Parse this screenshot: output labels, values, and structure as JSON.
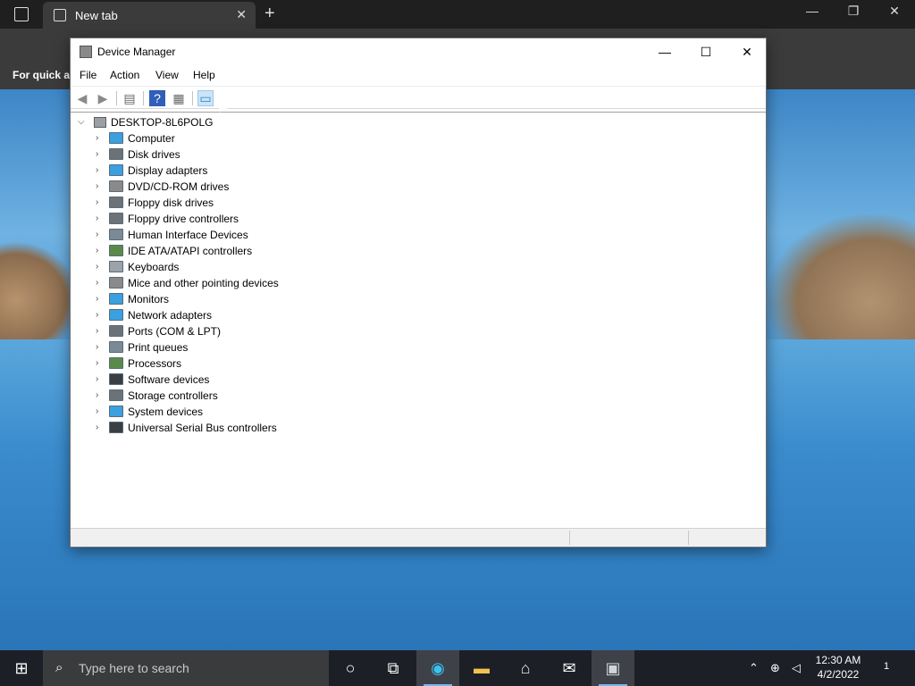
{
  "browser": {
    "tab_title": "New tab",
    "favorites_text": "For quick ac"
  },
  "window": {
    "title": "Device Manager",
    "controls": {
      "minimize": "—",
      "maximize": "☐",
      "close": "✕"
    }
  },
  "menu": [
    "File",
    "Action",
    "View",
    "Help"
  ],
  "toolbar": {
    "buttons": [
      "back-icon",
      "forward-icon",
      "properties-icon",
      "help-icon",
      "view-icon",
      "monitor-scan-icon"
    ]
  },
  "tree": {
    "root": "DESKTOP-8L6POLG",
    "items": [
      {
        "label": "Computer",
        "icon": "computer-icon",
        "color": "#3aa0e0"
      },
      {
        "label": "Disk drives",
        "icon": "disk-drive-icon",
        "color": "#6b7378"
      },
      {
        "label": "Display adapters",
        "icon": "display-adapter-icon",
        "color": "#3aa0e0"
      },
      {
        "label": "DVD/CD-ROM drives",
        "icon": "dvd-drive-icon",
        "color": "#8a8a8a"
      },
      {
        "label": "Floppy disk drives",
        "icon": "floppy-disk-icon",
        "color": "#6b7378"
      },
      {
        "label": "Floppy drive controllers",
        "icon": "floppy-controller-icon",
        "color": "#6b7378"
      },
      {
        "label": "Human Interface Devices",
        "icon": "hid-icon",
        "color": "#7a8a96"
      },
      {
        "label": "IDE ATA/ATAPI controllers",
        "icon": "ide-controller-icon",
        "color": "#5a8a4a"
      },
      {
        "label": "Keyboards",
        "icon": "keyboard-icon",
        "color": "#9aa3aa"
      },
      {
        "label": "Mice and other pointing devices",
        "icon": "mouse-icon",
        "color": "#8a8a8a"
      },
      {
        "label": "Monitors",
        "icon": "monitor-icon",
        "color": "#3aa0e0"
      },
      {
        "label": "Network adapters",
        "icon": "network-adapter-icon",
        "color": "#3aa0e0"
      },
      {
        "label": "Ports (COM & LPT)",
        "icon": "port-icon",
        "color": "#6b7378"
      },
      {
        "label": "Print queues",
        "icon": "printer-icon",
        "color": "#7a8a96"
      },
      {
        "label": "Processors",
        "icon": "processor-icon",
        "color": "#5a8a4a"
      },
      {
        "label": "Software devices",
        "icon": "software-device-icon",
        "color": "#3a3f44"
      },
      {
        "label": "Storage controllers",
        "icon": "storage-controller-icon",
        "color": "#6b7378"
      },
      {
        "label": "System devices",
        "icon": "system-device-icon",
        "color": "#3aa0e0"
      },
      {
        "label": "Universal Serial Bus controllers",
        "icon": "usb-icon",
        "color": "#3a3f44"
      }
    ]
  },
  "taskbar": {
    "search_placeholder": "Type here to search",
    "time": "12:30 AM",
    "date": "4/2/2022",
    "notification_count": "1"
  }
}
